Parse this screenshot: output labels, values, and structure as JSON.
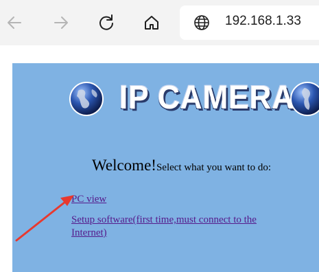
{
  "browser": {
    "url": "192.168.1.33",
    "icons": [
      "back-arrow-icon",
      "forward-arrow-icon",
      "refresh-icon",
      "home-icon",
      "globe-icon"
    ]
  },
  "page": {
    "logo_text": "IP CAMERA",
    "welcome": "Welcome!",
    "prompt": "Select what you want to do:",
    "links": [
      "PC view",
      "Setup software(first time,must connect to the",
      "Internet)"
    ],
    "colors": {
      "background": "#7fb2e3",
      "link": "#551a8b",
      "annotation_arrow": "#e8392f"
    }
  }
}
